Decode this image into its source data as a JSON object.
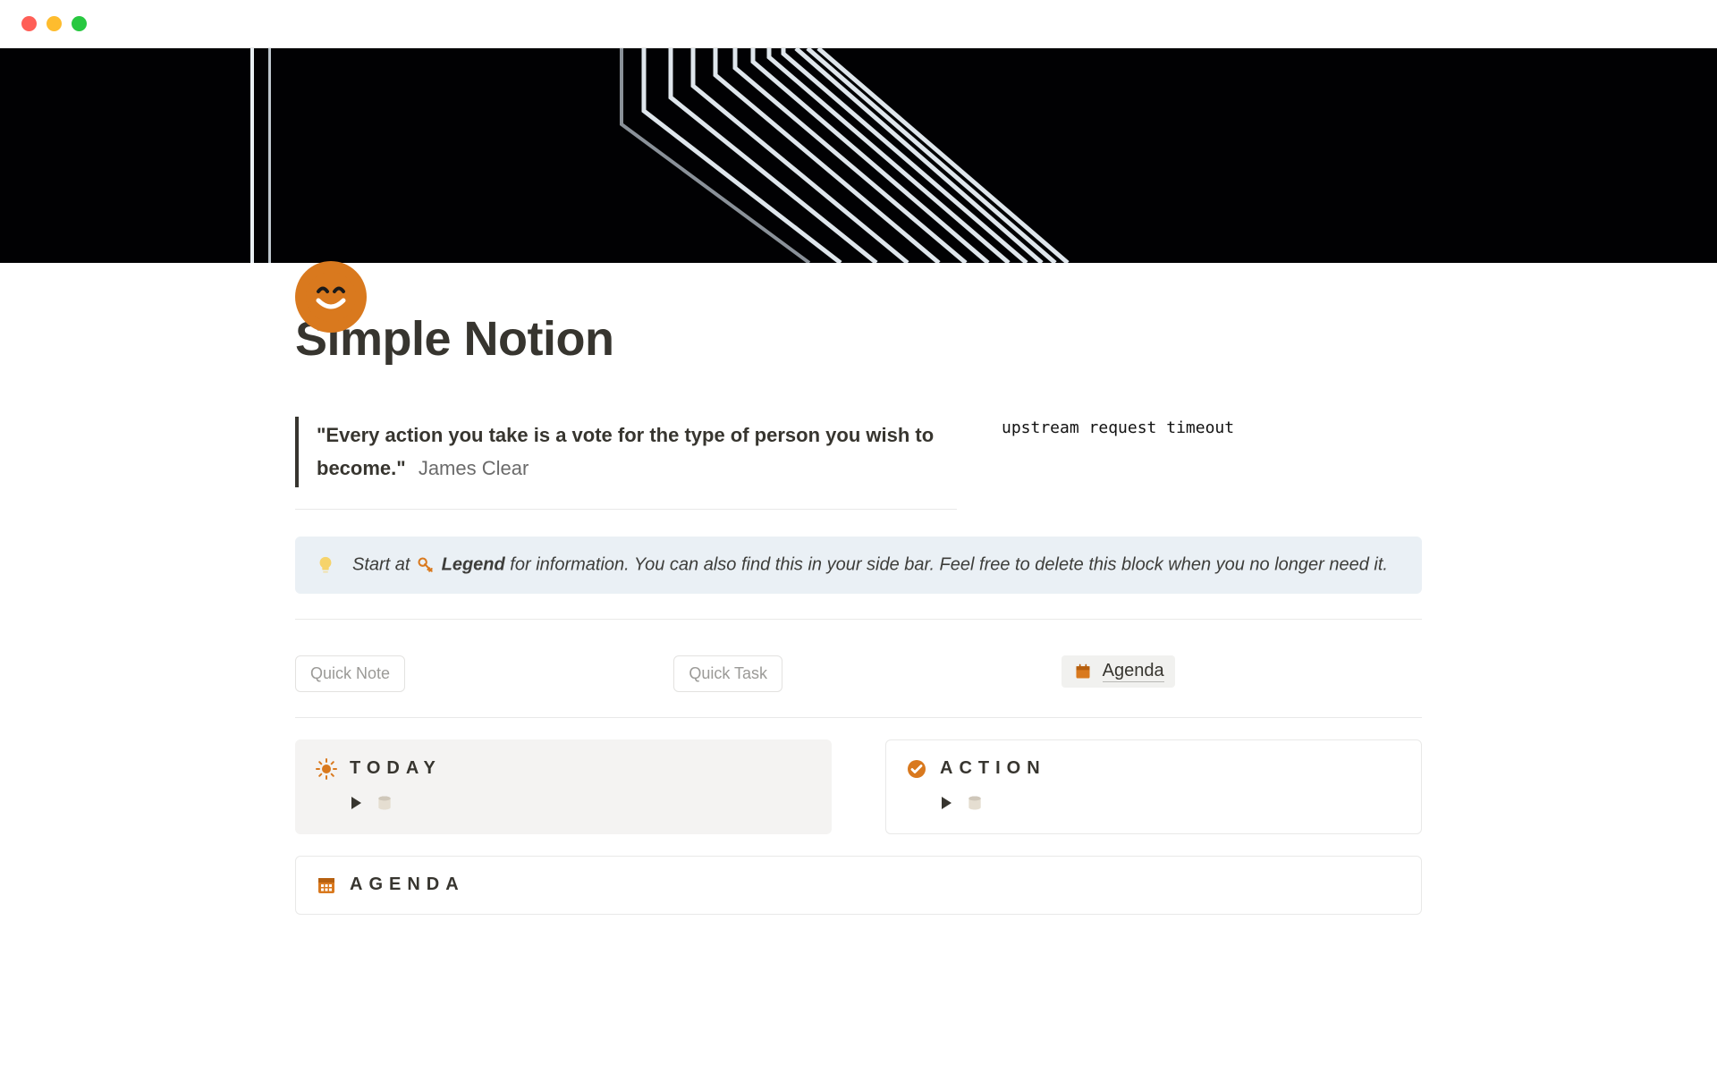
{
  "page": {
    "title": "Simple Notion"
  },
  "quote": {
    "text": "\"Every action you take is a vote for the type of person you wish to become.\"",
    "attribution": "James Clear"
  },
  "error": {
    "message": "upstream request timeout"
  },
  "callout": {
    "start": "Start at",
    "legend": "Legend",
    "rest": "for information. You can also find this in your side bar. Feel free to delete this block when you no longer need it."
  },
  "actions": {
    "quick_note": "Quick Note",
    "quick_task": "Quick Task",
    "agenda_link": "Agenda"
  },
  "cards": {
    "today": "TODAY",
    "action": "ACTION",
    "agenda": "AGENDA"
  }
}
